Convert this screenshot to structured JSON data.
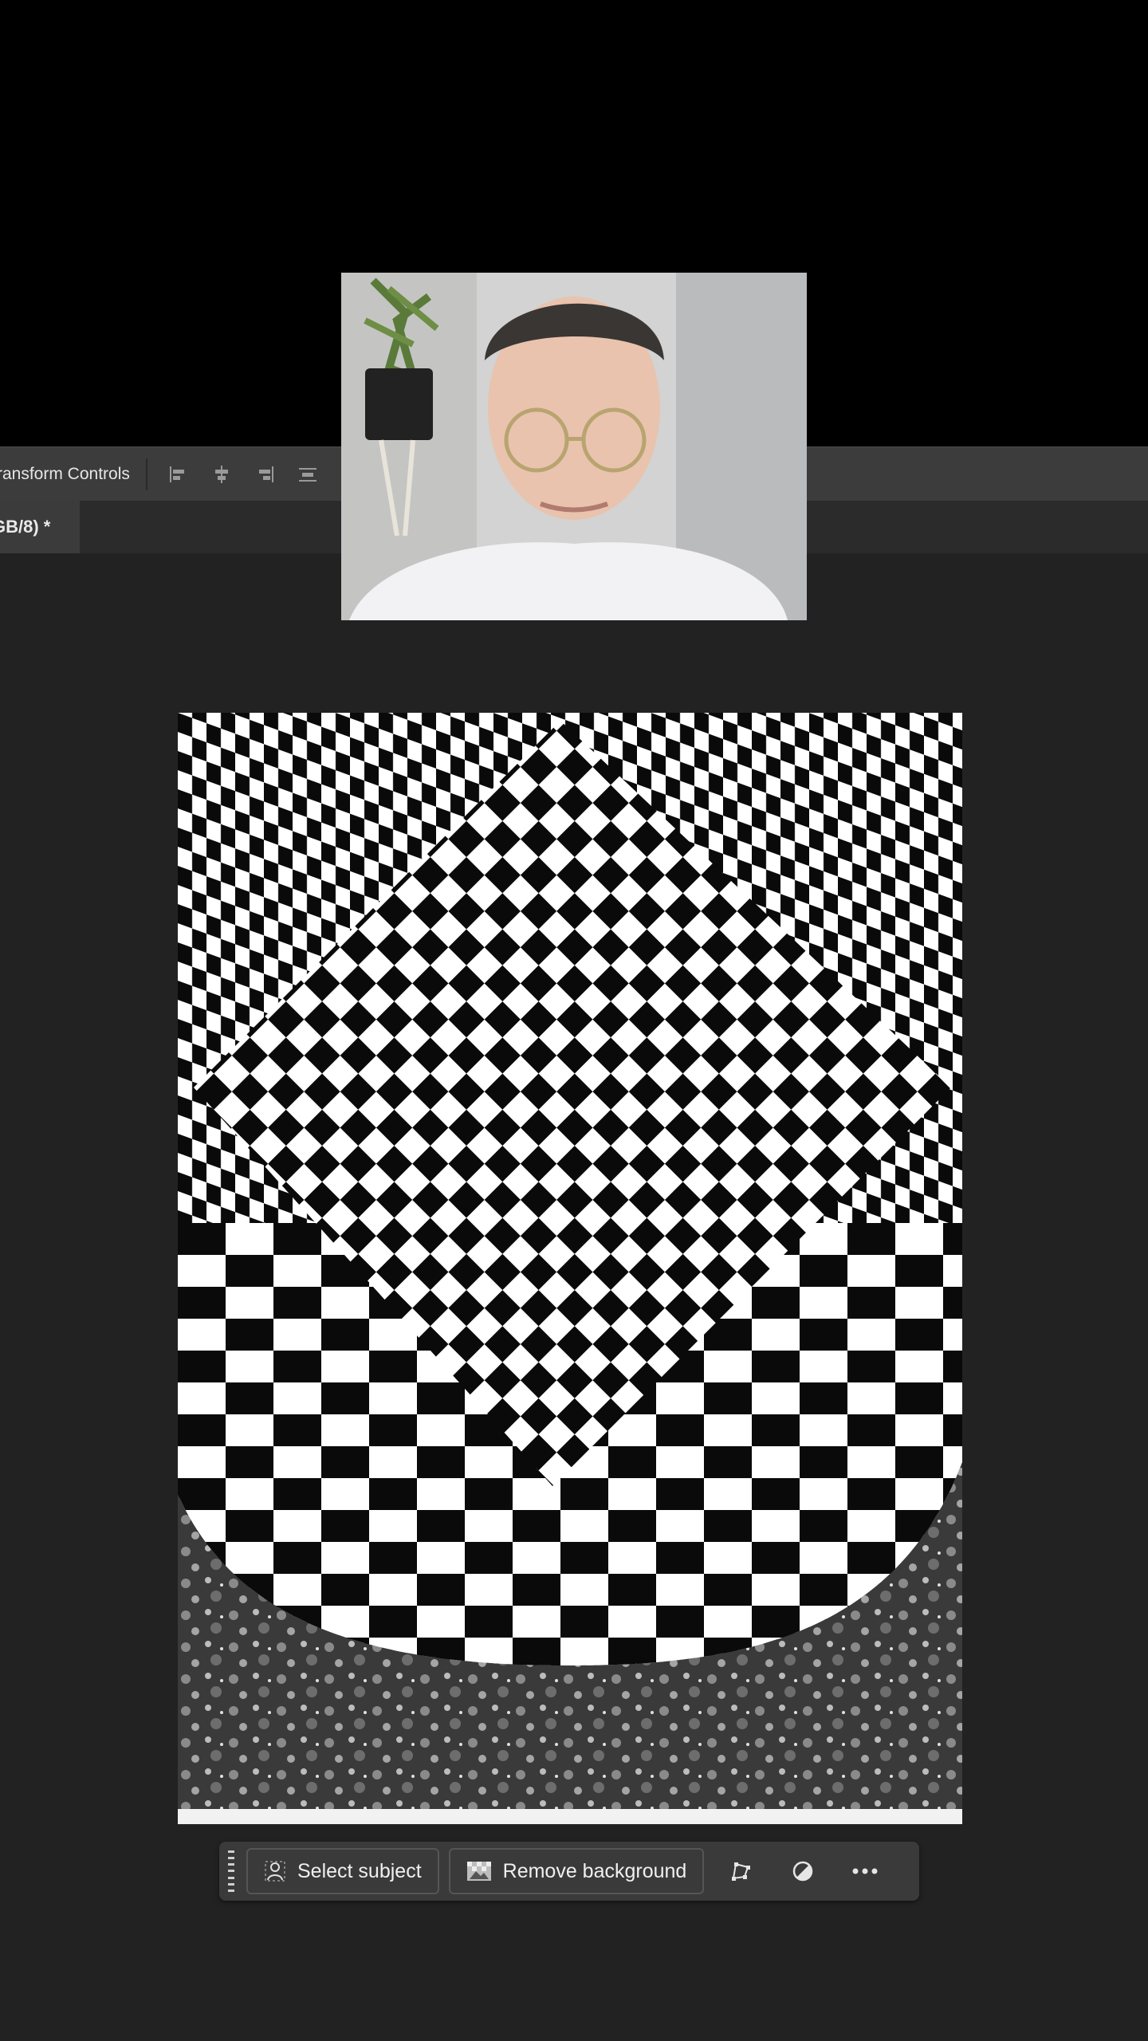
{
  "options_bar": {
    "transform_label": "ransform Controls",
    "align_icons": [
      "align-left-icon",
      "align-center-icon",
      "align-right-icon",
      "distribute-icon"
    ]
  },
  "document_tab": {
    "label": "GB/8) *"
  },
  "contextual_task_bar": {
    "select_subject_label": "Select subject",
    "remove_background_label": "Remove background",
    "icons": [
      "transform-icon",
      "adjust-icon",
      "more-icon"
    ]
  },
  "colors": {
    "options_bar": "#3c3c3c",
    "canvas_bg": "#232223",
    "task_bar": "#3a3a3a"
  }
}
